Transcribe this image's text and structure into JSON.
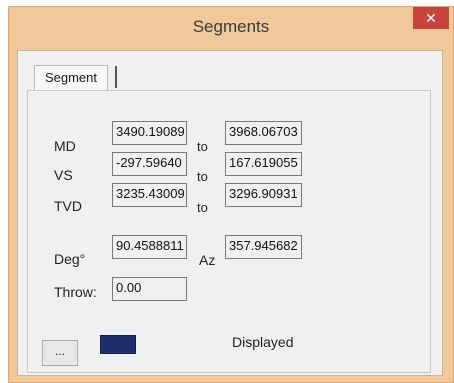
{
  "window": {
    "title": "Segments",
    "close_glyph": "✕"
  },
  "tab": {
    "label": "Segment"
  },
  "rows": {
    "md": {
      "label": "MD",
      "from": "3490.19089",
      "to_label": "to",
      "to": "3968.06703"
    },
    "vs": {
      "label": "VS",
      "from": "-297.59640",
      "to_label": "to",
      "to": "167.619055"
    },
    "tvd": {
      "label": "TVD",
      "from": "3235.43009",
      "to_label": "to",
      "to": "3296.90931"
    }
  },
  "deg": {
    "label": "Deg°",
    "value": "90.4588811",
    "az_label": "Az",
    "az_value": "357.945682"
  },
  "throw": {
    "label": "Throw:",
    "value": "0.00"
  },
  "footer": {
    "button_label": "...",
    "swatch_color": "#1c2f66",
    "status": "Displayed"
  }
}
